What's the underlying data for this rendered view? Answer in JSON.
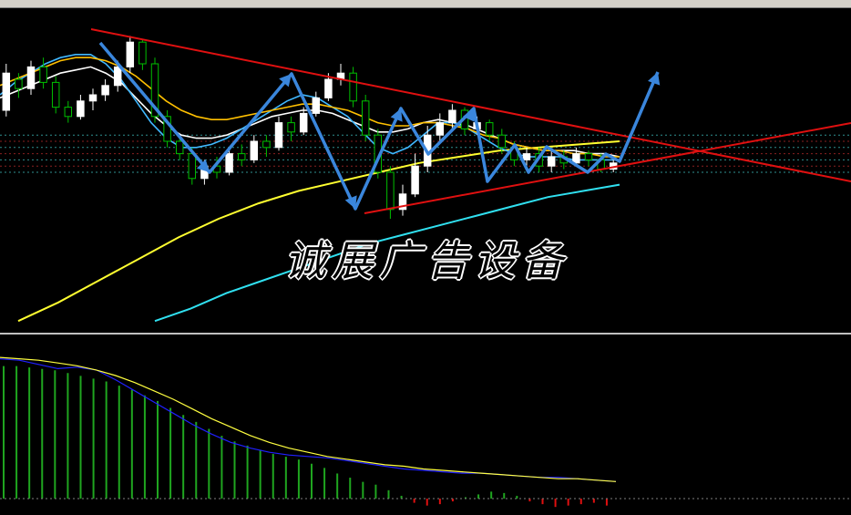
{
  "watermark": "诚展广告设备",
  "colors": {
    "background": "#000000",
    "up_candle": "#ffffff",
    "down_candle": "#00c000",
    "trendline": "#e01010",
    "arrow": "#3a86dc",
    "ma_long_yellow": "#ffff30",
    "ma_long_cyan": "#30e0f0",
    "macd_hist_pos": "#1fa51f",
    "macd_hist_neg": "#e01010",
    "macd_fast": "#2020ff",
    "macd_signal": "#ffff40",
    "ref_lines": "#2f8f8f"
  },
  "chart_data": [
    {
      "type": "candlestick",
      "title": "",
      "xlabel": "",
      "ylabel": "",
      "grid": false,
      "ylim": [
        0,
        100
      ],
      "candles": [
        [
          70,
          82,
          68,
          85
        ],
        [
          80,
          77,
          74,
          82
        ],
        [
          77,
          84,
          75,
          86
        ],
        [
          84,
          79,
          77,
          87
        ],
        [
          79,
          71,
          69,
          81
        ],
        [
          71,
          68,
          66,
          73
        ],
        [
          68,
          73,
          67,
          75
        ],
        [
          73,
          75,
          70,
          77
        ],
        [
          75,
          78,
          73,
          80
        ],
        [
          78,
          84,
          76,
          86
        ],
        [
          84,
          92,
          82,
          94
        ],
        [
          92,
          85,
          83,
          93
        ],
        [
          85,
          68,
          66,
          87
        ],
        [
          68,
          60,
          58,
          70
        ],
        [
          60,
          56,
          54,
          62
        ],
        [
          56,
          48,
          46,
          58
        ],
        [
          48,
          52,
          46,
          54
        ],
        [
          52,
          50,
          48,
          55
        ],
        [
          50,
          56,
          49,
          58
        ],
        [
          56,
          54,
          52,
          59
        ],
        [
          54,
          60,
          53,
          62
        ],
        [
          60,
          58,
          55,
          62
        ],
        [
          58,
          66,
          57,
          68
        ],
        [
          66,
          63,
          60,
          68
        ],
        [
          63,
          69,
          62,
          71
        ],
        [
          69,
          74,
          68,
          76
        ],
        [
          74,
          80,
          73,
          82
        ],
        [
          80,
          82,
          78,
          85
        ],
        [
          82,
          73,
          71,
          84
        ],
        [
          73,
          62,
          60,
          75
        ],
        [
          62,
          50,
          48,
          64
        ],
        [
          50,
          38,
          35,
          52
        ],
        [
          38,
          43,
          36,
          46
        ],
        [
          43,
          52,
          42,
          56
        ],
        [
          52,
          62,
          50,
          65
        ],
        [
          62,
          66,
          60,
          69
        ],
        [
          66,
          70,
          64,
          72
        ],
        [
          70,
          64,
          62,
          71
        ],
        [
          64,
          66,
          62,
          68
        ],
        [
          66,
          62,
          60,
          67
        ],
        [
          62,
          58,
          56,
          64
        ],
        [
          58,
          54,
          52,
          60
        ],
        [
          54,
          56,
          52,
          58
        ],
        [
          56,
          52,
          50,
          58
        ],
        [
          52,
          55,
          50,
          57
        ],
        [
          55,
          53,
          51,
          57
        ],
        [
          53,
          56,
          52,
          58
        ],
        [
          56,
          54,
          52,
          57
        ],
        [
          54,
          51,
          50,
          56
        ],
        [
          51,
          53,
          50,
          55
        ]
      ],
      "moving_averages": [
        {
          "color": "#ffffff",
          "values": [
            74,
            76,
            78,
            80,
            82,
            83,
            84,
            82,
            79,
            74,
            69,
            65,
            62,
            61,
            61,
            62,
            64,
            66,
            68,
            69,
            70,
            70,
            69,
            67,
            65,
            63,
            63,
            64,
            66,
            67,
            66,
            65,
            63,
            61,
            59,
            58,
            57,
            57,
            57,
            56,
            56,
            55
          ]
        },
        {
          "color": "#40b8ff",
          "values": [
            75,
            79,
            82,
            85,
            87,
            88,
            88,
            85,
            80,
            73,
            66,
            61,
            58,
            58,
            59,
            61,
            64,
            67,
            70,
            73,
            75,
            74,
            71,
            68,
            63,
            58,
            56,
            58,
            62,
            66,
            66,
            64,
            61,
            58,
            56,
            55,
            55,
            55,
            54,
            54,
            54,
            54
          ]
        },
        {
          "color": "#ffc000",
          "values": [
            78,
            80,
            82,
            84,
            86,
            87,
            87,
            86,
            84,
            81,
            77,
            73,
            70,
            68,
            67,
            67,
            68,
            69,
            70,
            71,
            72,
            72,
            71,
            70,
            68,
            66,
            65,
            65,
            66,
            66,
            65,
            64,
            62,
            61,
            59,
            58,
            57,
            57,
            56,
            56,
            55,
            55
          ]
        }
      ],
      "long_averages": [
        {
          "color": "#ffff30",
          "values": [
            2,
            8,
            15,
            22,
            29,
            35,
            40,
            44,
            47,
            50,
            53,
            55,
            57,
            58,
            59,
            60
          ]
        },
        {
          "color": "#30e0f0",
          "values": [
            2,
            6,
            11,
            15,
            19,
            23,
            27,
            30,
            33,
            36,
            39,
            42,
            44,
            46
          ]
        }
      ]
    },
    {
      "type": "bar",
      "title": "",
      "xlabel": "",
      "ylabel": "",
      "grid": false,
      "ylim": [
        -1,
        10
      ],
      "values": [
        9.5,
        9.5,
        9.4,
        9.3,
        9.2,
        9.0,
        8.8,
        8.6,
        8.4,
        8.1,
        7.8,
        7.4,
        7.0,
        6.5,
        6.0,
        5.5,
        5.0,
        4.5,
        4.1,
        3.8,
        3.5,
        3.2,
        3.0,
        2.8,
        2.5,
        2.2,
        1.8,
        1.5,
        1.2,
        1.0,
        0.6,
        0.2,
        -0.3,
        -0.5,
        -0.4,
        -0.2,
        0.1,
        0.3,
        0.5,
        0.4,
        0.2,
        -0.2,
        -0.4,
        -0.6,
        -0.5,
        -0.4,
        -0.3,
        -0.5
      ],
      "series": [
        {
          "color": "#2020ff",
          "values": [
            9.5,
            9.4,
            9.1,
            8.8,
            8.9,
            8.7,
            8.0,
            7.2,
            6.4,
            5.6,
            4.8,
            4.1,
            3.5,
            3.1,
            2.8,
            2.6,
            2.5,
            2.4,
            2.2,
            2.0,
            1.8,
            1.6,
            1.5,
            1.4,
            1.3,
            1.3,
            1.2,
            1.1,
            1.0,
            1.0,
            0.9,
            0.8,
            0.7
          ]
        },
        {
          "color": "#ffff40",
          "values": [
            9.6,
            9.5,
            9.4,
            9.2,
            9.0,
            8.7,
            8.3,
            7.8,
            7.2,
            6.6,
            5.9,
            5.2,
            4.6,
            4.0,
            3.5,
            3.1,
            2.8,
            2.5,
            2.3,
            2.1,
            1.9,
            1.8,
            1.6,
            1.5,
            1.4,
            1.3,
            1.2,
            1.1,
            1.0,
            0.9,
            0.9,
            0.8,
            0.7
          ]
        }
      ]
    }
  ]
}
